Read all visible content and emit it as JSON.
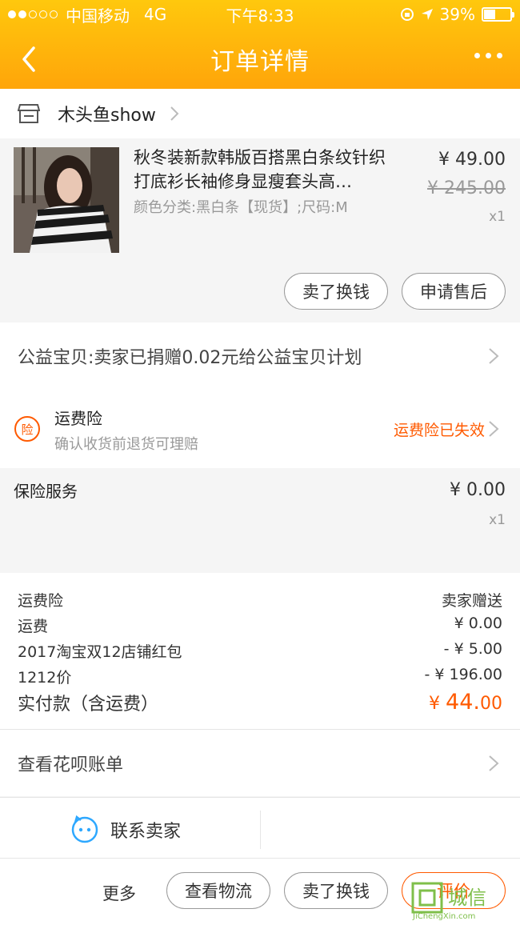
{
  "status_bar": {
    "carrier": "中国移动",
    "network": "4G",
    "time": "下午8:33",
    "battery": "39%",
    "signal_bars": 2
  },
  "nav": {
    "title": "订单详情"
  },
  "shop": {
    "name": "木头鱼show"
  },
  "product": {
    "title": "秋冬装新款韩版百搭黑白条纹针织打底衫长袖修身显瘦套头高…",
    "sku": "颜色分类:黑白条【现货】;尺码:M",
    "price": "¥ 49.00",
    "original_price": "¥ 245.00",
    "quantity": "x1",
    "buttons": [
      "卖了换钱",
      "申请售后"
    ]
  },
  "charity": {
    "text": "公益宝贝:卖家已捐赠0.02元给公益宝贝计划"
  },
  "insurance": {
    "icon_char": "险",
    "title": "运费险",
    "subtitle": "确认收货前退货可理赔",
    "status": "运费险已失效"
  },
  "service": {
    "title": "保险服务",
    "price": "¥ 0.00",
    "quantity": "x1"
  },
  "summary": {
    "rows": [
      {
        "label": "运费险",
        "value": "卖家赠送"
      },
      {
        "label": "运费",
        "value": "¥ 0.00"
      },
      {
        "label": "2017淘宝双12店铺红包",
        "value": "- ¥ 5.00"
      },
      {
        "label": "1212价",
        "value": "- ¥ 196.00"
      }
    ],
    "total_label": "实付款（含运费）",
    "total_currency": "¥",
    "total_int": "44.",
    "total_dec": "00"
  },
  "huabei": {
    "label": "查看花呗账单"
  },
  "contact": {
    "label": "联系卖家"
  },
  "actions": {
    "more": "更多",
    "buttons": [
      "查看物流",
      "卖了换钱",
      "评价"
    ]
  },
  "watermark": {
    "text": "城信",
    "sub": "JiChengXin.com"
  },
  "colors": {
    "header_top": "#ffc80d",
    "header_bottom": "#ffa50a",
    "accent": "#ff5a00"
  }
}
